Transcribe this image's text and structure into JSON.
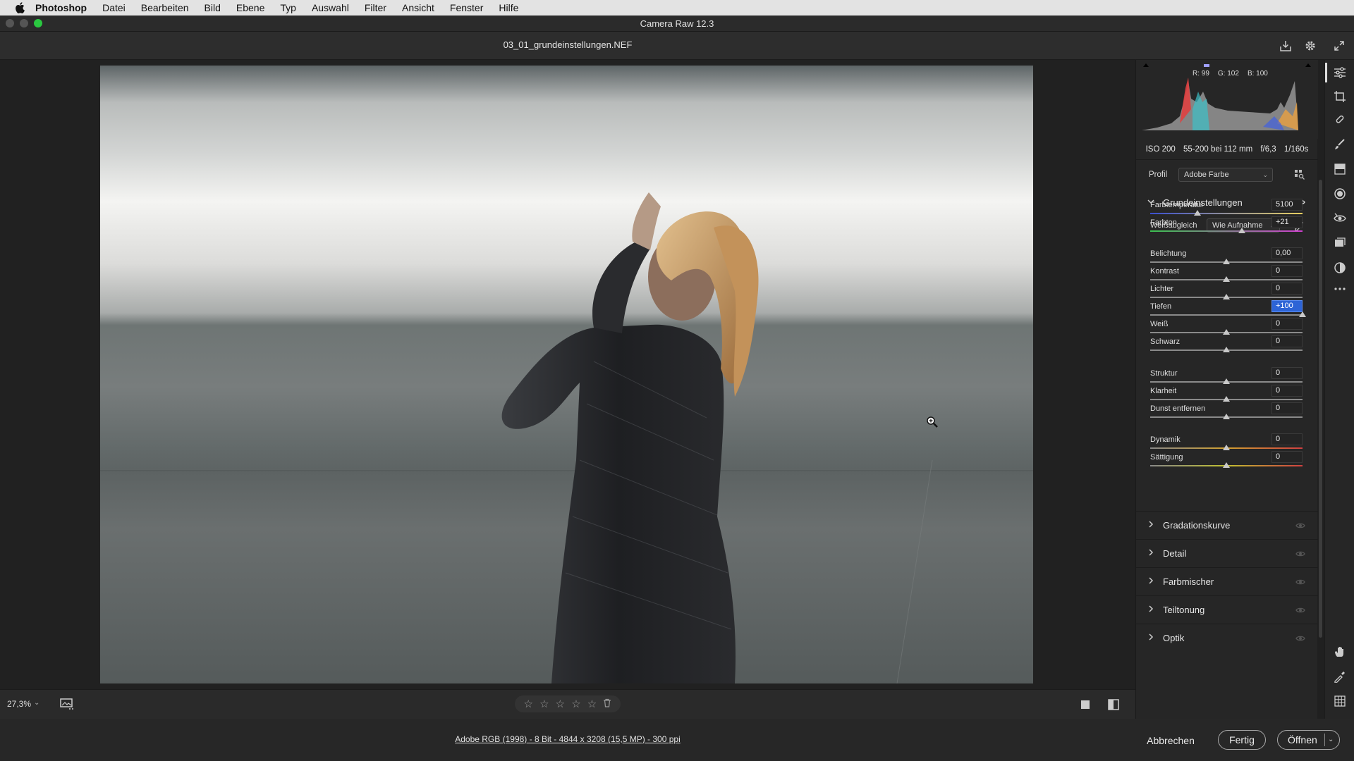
{
  "menubar": {
    "app": "Photoshop",
    "items": [
      "Datei",
      "Bearbeiten",
      "Bild",
      "Ebene",
      "Typ",
      "Auswahl",
      "Filter",
      "Ansicht",
      "Fenster",
      "Hilfe"
    ]
  },
  "window": {
    "title": "Camera Raw 12.3"
  },
  "file": {
    "name": "03_01_grundeinstellungen.NEF"
  },
  "histogram": {
    "r_label": "R:",
    "r": "99",
    "g_label": "G:",
    "g": "102",
    "b_label": "B:",
    "b": "100"
  },
  "exif": {
    "iso": "ISO 200",
    "lens": "55-200 bei 112 mm",
    "aperture": "f/6,3",
    "shutter": "1/160s"
  },
  "profile": {
    "label": "Profil",
    "value": "Adobe Farbe"
  },
  "basic": {
    "title": "Grundeinstellungen",
    "wb_label": "Weißabgleich",
    "wb_value": "Wie Aufnahme",
    "sliders": [
      {
        "label": "Farbtemperatur",
        "value": "5100",
        "level": 0.31
      },
      {
        "label": "Farbton",
        "value": "+21",
        "level": 0.6
      },
      {
        "label": "Belichtung",
        "value": "0,00",
        "level": 0.5
      },
      {
        "label": "Kontrast",
        "value": "0",
        "level": 0.5
      },
      {
        "label": "Lichter",
        "value": "0",
        "level": 0.5
      },
      {
        "label": "Tiefen",
        "value": "+100",
        "level": 1.0
      },
      {
        "label": "Weiß",
        "value": "0",
        "level": 0.5
      },
      {
        "label": "Schwarz",
        "value": "0",
        "level": 0.5
      },
      {
        "label": "Struktur",
        "value": "0",
        "level": 0.5
      },
      {
        "label": "Klarheit",
        "value": "0",
        "level": 0.5
      },
      {
        "label": "Dunst entfernen",
        "value": "0",
        "level": 0.5
      },
      {
        "label": "Dynamik",
        "value": "0",
        "level": 0.5
      },
      {
        "label": "Sättigung",
        "value": "0",
        "level": 0.5
      }
    ]
  },
  "sections": [
    "Gradationskurve",
    "Detail",
    "Farbmischer",
    "Teiltonung",
    "Optik"
  ],
  "canvas": {
    "zoom": "27,3%",
    "stars": [
      "☆",
      "☆",
      "☆",
      "☆",
      "☆"
    ]
  },
  "footer": {
    "workflow": "Adobe RGB (1998) - 8 Bit - 4844 x 3208 (15,5 MP) - 300 ppi",
    "cancel": "Abbrechen",
    "done": "Fertig",
    "open": "Öffnen"
  },
  "colors": {
    "accent": "#2d64d6",
    "max_button": "#2ac840",
    "panel": "#262626"
  }
}
